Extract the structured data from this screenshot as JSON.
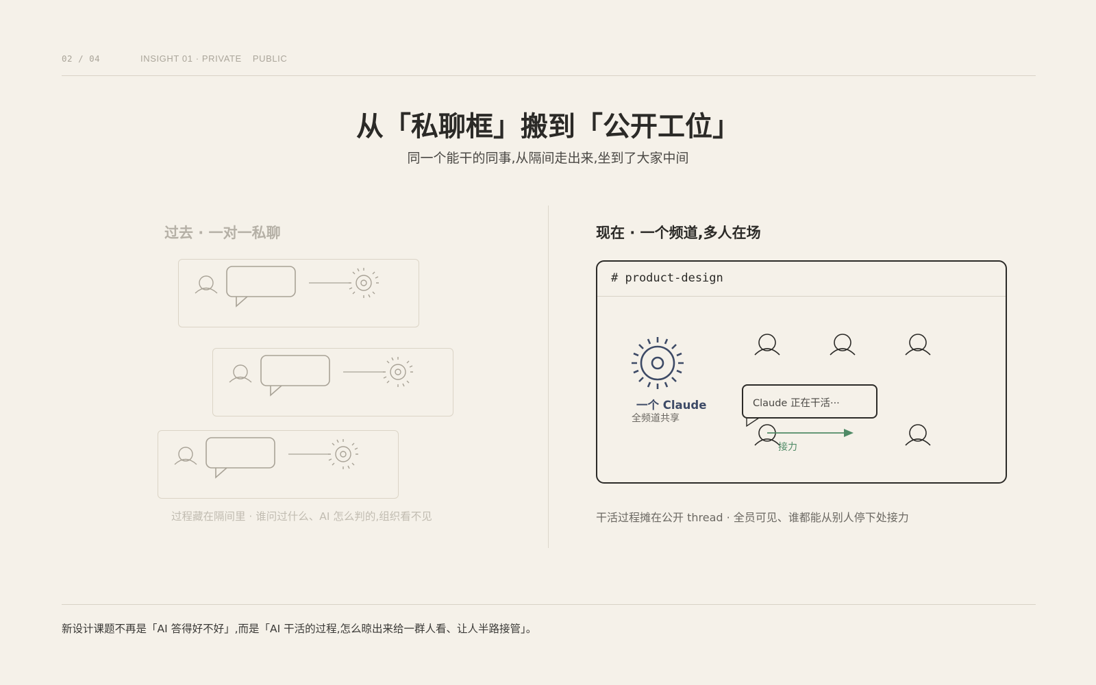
{
  "header": {
    "page_number": "02 / 04",
    "insight": "INSIGHT 01 · PRIVATE",
    "insight_tail": "PUBLIC"
  },
  "title": "从「私聊框」搬到「公开工位」",
  "subtitle": "同一个能干的同事,从隔间走出来,坐到了大家中间",
  "past": {
    "label": "过去 · 一对一私聊",
    "caption": "过程藏在隔间里 · 谁问过什么、AI 怎么判的,组织看不见"
  },
  "now": {
    "label": "现在 · 一个频道,多人在场",
    "channel_name": "# product-design",
    "claude_name": "一个 Claude",
    "claude_sub": "全频道共享",
    "bubble_text": "Claude 正在干活···",
    "relay_label": "接力",
    "caption": "干活过程摊在公开 thread · 全员可见、谁都能从别人停下处接力"
  },
  "footer": "新设计课题不再是「AI 答得好不好」,而是「AI 干活的过程,怎么晾出来给一群人看、让人半路接管」。",
  "colors": {
    "background": "#f5f1e9",
    "ink": "#2b2a27",
    "faded": "#b5b0a6",
    "claude_navy": "#3d4a66",
    "relay_green": "#4f8a66"
  }
}
